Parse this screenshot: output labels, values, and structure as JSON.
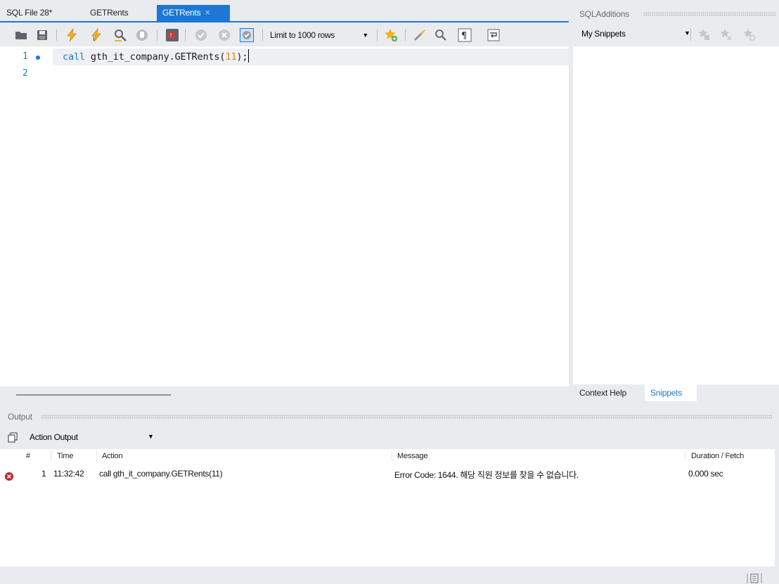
{
  "editor_tabs": [
    {
      "label": "SQL File 28*"
    },
    {
      "label": "GETRents"
    },
    {
      "label": "GETRents",
      "active": true
    }
  ],
  "tab_close_glyph": "×",
  "toolbar": {
    "limit_label": "Limit to 1000 rows",
    "icons": [
      "open-folder-icon",
      "save-icon",
      "execute-icon",
      "execute-current-icon",
      "explain-icon",
      "stop-icon",
      "toggle-error-stop-icon",
      "commit-icon",
      "rollback-icon",
      "autocommit-icon",
      "add-snippet-icon",
      "beautify-icon",
      "find-icon",
      "invisible-chars-icon",
      "word-wrap-icon"
    ]
  },
  "editor": {
    "lines": [
      {
        "number": "1",
        "keyword": "call",
        "text": " gth_it_company.GETRents(",
        "arg": "11",
        "tail": ");"
      },
      {
        "number": "2"
      }
    ]
  },
  "side_panel": {
    "title": "SQLAdditions",
    "snippet_select": "My Snippets",
    "tabs": [
      "Context Help",
      "Snippets"
    ],
    "active_tab": "Snippets"
  },
  "output": {
    "title": "Output",
    "select": "Action Output",
    "columns": [
      "#",
      "Time",
      "Action",
      "Message",
      "Duration / Fetch"
    ],
    "rows": [
      {
        "status": "error",
        "index": "1",
        "time": "11:32:42",
        "action": "call gth_it_company.GETRents(11)",
        "message": "Error Code: 1644. 해당 직원 정보를 찾을 수 없습니다.",
        "duration": "0.000 sec"
      }
    ]
  },
  "colors": {
    "accent": "#1c78d4",
    "error": "#c0262d",
    "panel_bg": "#e9ebee"
  }
}
